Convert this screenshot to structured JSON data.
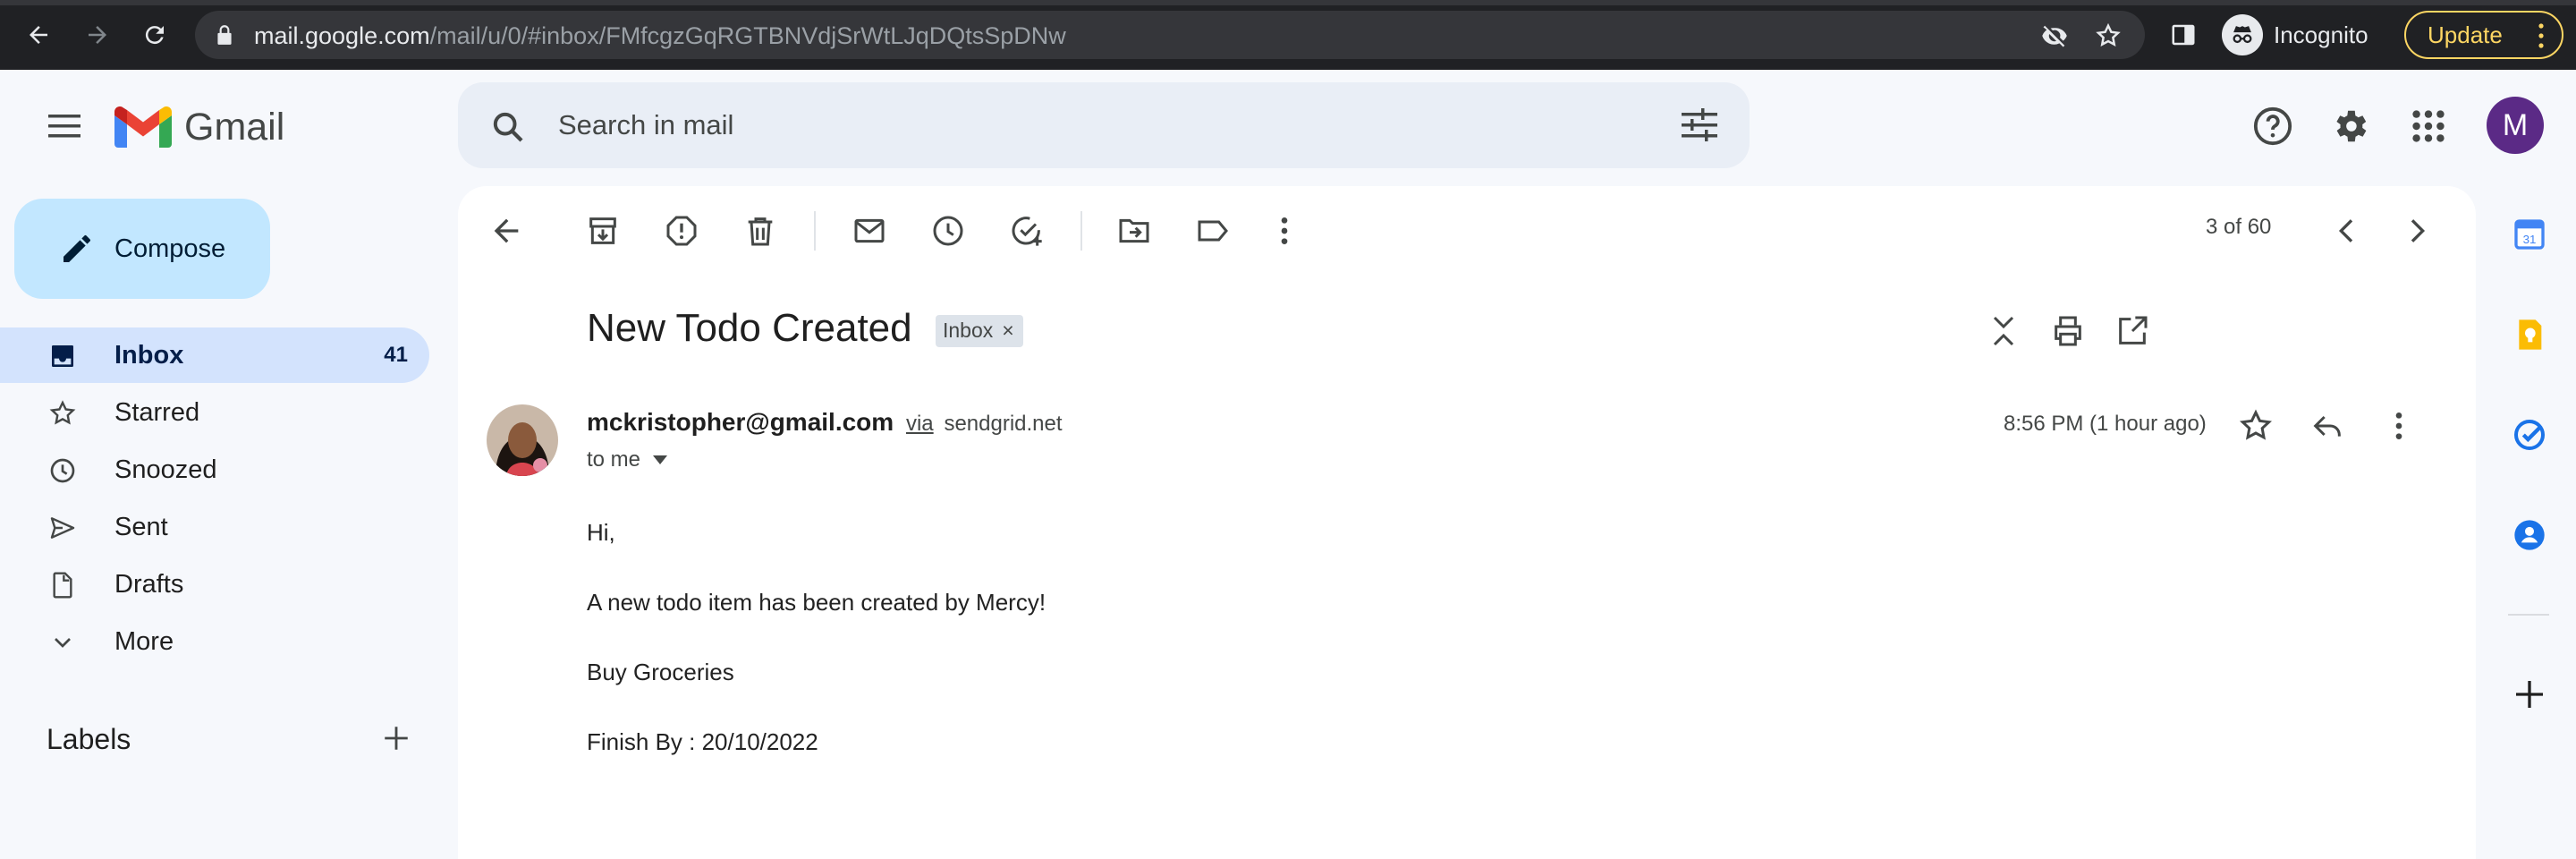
{
  "browser": {
    "url_host": "mail.google.com",
    "url_path": "/mail/u/0/#inbox/FMfcgzGqRGTBNVdjSrWtLJqDQtsSpDNw",
    "incognito_label": "Incognito",
    "update_label": "Update"
  },
  "header": {
    "logo_text": "Gmail",
    "search_placeholder": "Search in mail",
    "account_initial": "M",
    "colors": {
      "account_bg": "#5b2a86",
      "search_bg": "#e9eef6"
    }
  },
  "sidebar": {
    "compose_label": "Compose",
    "items": [
      {
        "label": "Inbox",
        "count": "41",
        "icon": "inbox-icon",
        "active": true
      },
      {
        "label": "Starred",
        "count": "",
        "icon": "star-icon",
        "active": false
      },
      {
        "label": "Snoozed",
        "count": "",
        "icon": "clock-icon",
        "active": false
      },
      {
        "label": "Sent",
        "count": "",
        "icon": "send-icon",
        "active": false
      },
      {
        "label": "Drafts",
        "count": "",
        "icon": "draft-icon",
        "active": false
      },
      {
        "label": "More",
        "count": "",
        "icon": "chevron-down-icon",
        "active": false
      }
    ],
    "labels_title": "Labels"
  },
  "toolbar": {
    "pager_text": "3 of 60"
  },
  "message": {
    "subject": "New Todo Created",
    "label_chip": "Inbox",
    "label_chip_remove": "×",
    "sender_email": "mckristopher@gmail.com",
    "via": "via",
    "via_domain": "sendgrid.net",
    "recipient": "to me",
    "time": "8:56 PM (1 hour ago)",
    "body": [
      "Hi,",
      "A new todo item has been created by Mercy!",
      "Buy Groceries",
      "Finish By : 20/10/2022"
    ]
  }
}
